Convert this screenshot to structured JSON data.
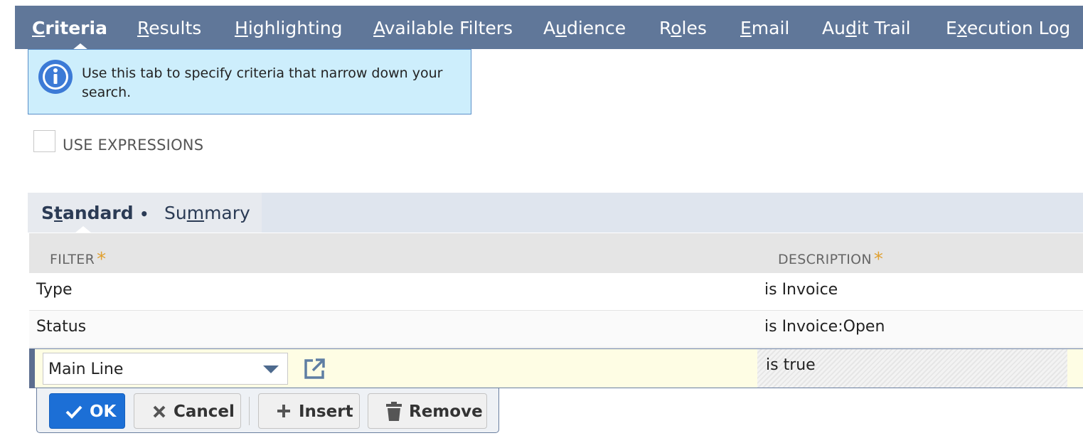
{
  "tabs": [
    {
      "pre": "",
      "ul": "C",
      "post": "riteria",
      "active": true
    },
    {
      "pre": "",
      "ul": "R",
      "post": "esults"
    },
    {
      "pre": "",
      "ul": "H",
      "post": "ighlighting"
    },
    {
      "pre": "",
      "ul": "A",
      "post": "vailable Filters"
    },
    {
      "pre": "A",
      "ul": "u",
      "post": "dience"
    },
    {
      "pre": "R",
      "ul": "o",
      "post": "les"
    },
    {
      "pre": "",
      "ul": "E",
      "post": "mail"
    },
    {
      "pre": "Au",
      "ul": "d",
      "post": "it Trail"
    },
    {
      "pre": "E",
      "ul": "x",
      "post": "ecution Log"
    }
  ],
  "info": {
    "message": "Use this tab to specify criteria that narrow down your search.",
    "icon": "info-circle-icon"
  },
  "use_expressions": {
    "label": "USE EXPRESSIONS",
    "checked": false
  },
  "subtabs": {
    "standard": {
      "pre": "S",
      "ul": "t",
      "post": "andard",
      "dot": "•"
    },
    "summary": {
      "pre": "Su",
      "ul": "m",
      "post": "mary"
    }
  },
  "table": {
    "headers": {
      "filter": "FILTER",
      "description": "DESCRIPTION",
      "required": "*"
    },
    "rows": [
      {
        "filter": "Type",
        "description": "is Invoice"
      },
      {
        "filter": "Status",
        "description": "is Invoice:Open"
      }
    ],
    "edit_row": {
      "filter_value": "Main Line",
      "description": "is true"
    }
  },
  "buttons": {
    "ok": "OK",
    "cancel": "Cancel",
    "insert": "Insert",
    "remove": "Remove"
  },
  "colors": {
    "topbar": "#607799",
    "info_bg": "#cdeefc",
    "primary": "#1c6fd6",
    "edit_row_bg": "#fefde4",
    "required_star": "#e0a030"
  }
}
